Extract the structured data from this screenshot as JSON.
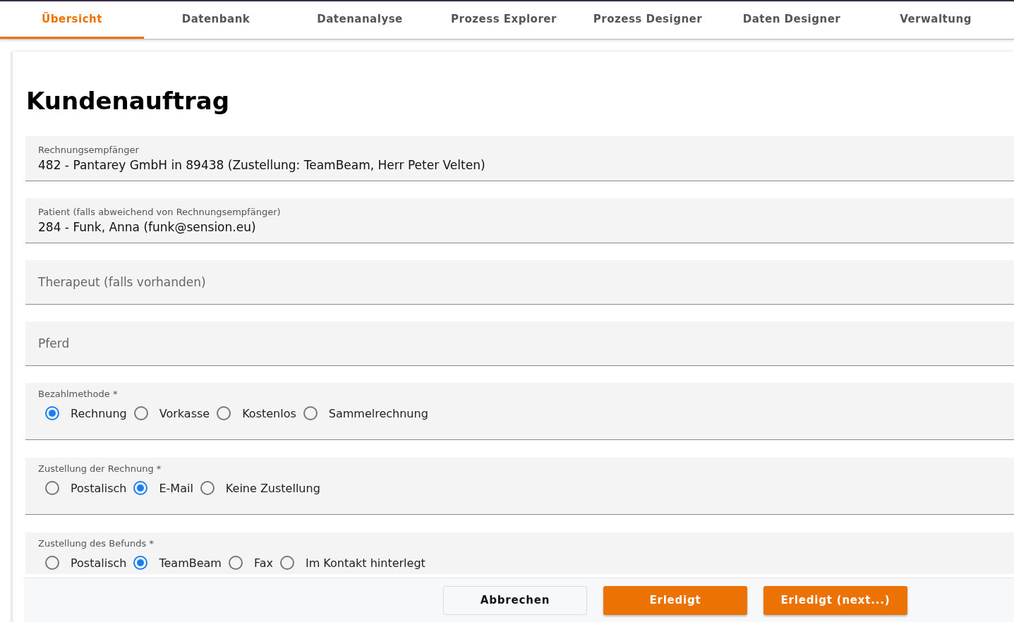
{
  "tabs": [
    {
      "label": "Übersicht",
      "selected": true
    },
    {
      "label": "Datenbank",
      "selected": false
    },
    {
      "label": "Datenanalyse",
      "selected": false
    },
    {
      "label": "Prozess Explorer",
      "selected": false
    },
    {
      "label": "Prozess Designer",
      "selected": false
    },
    {
      "label": "Daten Designer",
      "selected": false
    },
    {
      "label": "Verwaltung",
      "selected": false
    }
  ],
  "form": {
    "title": "Kundenauftrag",
    "fields": [
      {
        "kind": "text",
        "label": "Rechnungsempfänger",
        "value": "482 - Pantarey GmbH in 89438 (Zustellung: TeamBeam, Herr Peter Velten)"
      },
      {
        "kind": "text",
        "label": "Patient (falls abweichend von Rechnungsempfänger)",
        "value": "284 - Funk, Anna (funk@sension.eu)"
      },
      {
        "kind": "text",
        "placeholder": "Therapeut (falls vorhanden)"
      },
      {
        "kind": "text",
        "placeholder": "Pferd"
      },
      {
        "kind": "radio",
        "label": "Bezahlmethode *",
        "options": [
          {
            "label": "Rechnung",
            "selected": true
          },
          {
            "label": "Vorkasse",
            "selected": false
          },
          {
            "label": "Kostenlos",
            "selected": false
          },
          {
            "label": "Sammelrechnung",
            "selected": false
          }
        ]
      },
      {
        "kind": "radio",
        "label": "Zustellung der Rechnung *",
        "options": [
          {
            "label": "Postalisch",
            "selected": false
          },
          {
            "label": "E-Mail",
            "selected": true
          },
          {
            "label": "Keine Zustellung",
            "selected": false
          }
        ]
      },
      {
        "kind": "radio",
        "label": "Zustellung des Befunds *",
        "options": [
          {
            "label": "Postalisch",
            "selected": false
          },
          {
            "label": "TeamBeam",
            "selected": true
          },
          {
            "label": "Fax",
            "selected": false
          },
          {
            "label": "Im Kontakt hinterlegt",
            "selected": false
          }
        ]
      }
    ]
  },
  "buttons": [
    {
      "label": "Abbrechen",
      "kind": "secondary"
    },
    {
      "label": "Erledigt",
      "kind": "primary"
    },
    {
      "label": "Erledigt (next...)",
      "kind": "primary"
    }
  ]
}
